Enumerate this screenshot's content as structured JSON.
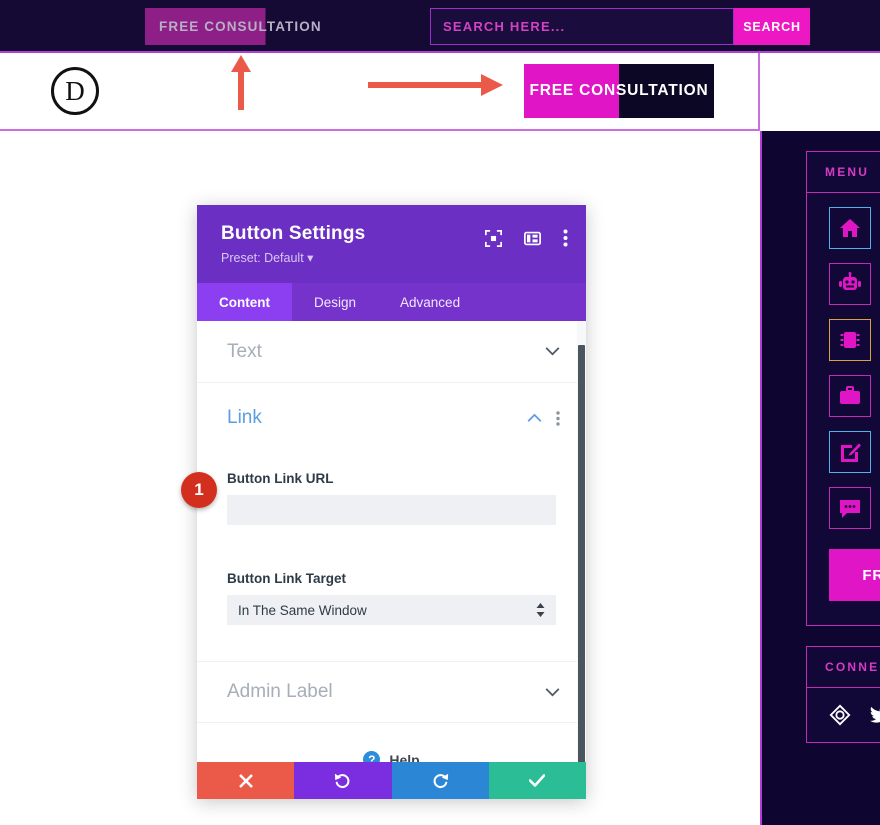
{
  "topbar": {
    "consult_label": "FREE CONSULTATION",
    "search_placeholder": "SEARCH HERE...",
    "search_value": "",
    "search_button_label": "SEARCH"
  },
  "site_header": {
    "logo_letter": "D",
    "cta_label": "FREE CONSULTATION"
  },
  "sidebar": {
    "menu_title": "MENU",
    "items": [
      {
        "icon": "home-icon",
        "border_color": "#4fb3e8"
      },
      {
        "icon": "robot-icon",
        "border_color": "#c42ab8"
      },
      {
        "icon": "chip-icon",
        "border_color": "#d8a23c"
      },
      {
        "icon": "briefcase-icon",
        "border_color": "#c42ab8"
      },
      {
        "icon": "edit-icon",
        "border_color": "#4fb3e8"
      },
      {
        "icon": "chat-icon",
        "border_color": "#c42ab8"
      }
    ],
    "cta_label": "FREE",
    "connect_title": "CONNECT",
    "social": [
      "dribbble-icon",
      "twitter-icon"
    ]
  },
  "modal": {
    "title": "Button Settings",
    "preset": "Preset: Default",
    "header_icons": [
      "focus-icon",
      "layout-icon",
      "more-vertical-icon"
    ],
    "tabs": [
      {
        "label": "Content",
        "active": true
      },
      {
        "label": "Design",
        "active": false
      },
      {
        "label": "Advanced",
        "active": false
      }
    ],
    "sections": [
      {
        "label": "Text",
        "open": false
      },
      {
        "label": "Link",
        "open": true
      },
      {
        "label": "Admin Label",
        "open": false
      }
    ],
    "fields": {
      "url_label": "Button Link URL",
      "url_value": "",
      "url_placeholder": "",
      "target_label": "Button Link Target",
      "target_value": "In The Same Window"
    },
    "help_label": "Help",
    "footer": [
      {
        "name": "cancel",
        "glyph": "✖"
      },
      {
        "name": "undo",
        "glyph": "↺"
      },
      {
        "name": "redo",
        "glyph": "↻"
      },
      {
        "name": "save",
        "glyph": "✔"
      }
    ]
  },
  "annotations": {
    "badge_number": "1"
  },
  "colors": {
    "accent_magenta": "#e016c6",
    "dark_navy": "#0e0630",
    "modal_purple": "#6b2fc4",
    "annotation_red": "#eb5a49",
    "badge_red": "#d32f1f"
  }
}
